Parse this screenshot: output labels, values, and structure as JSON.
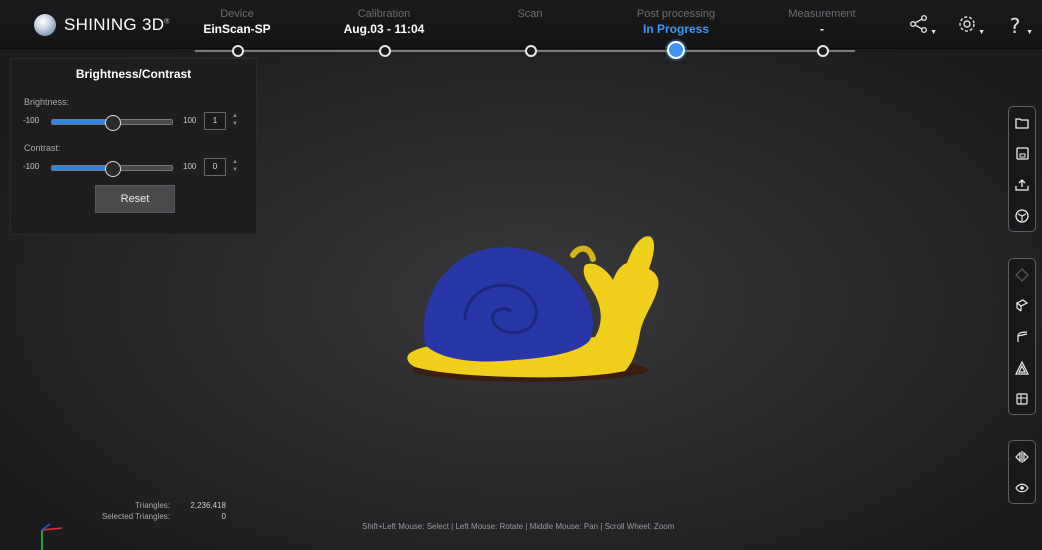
{
  "app": {
    "brand": "SHINING 3D",
    "brand_mark": "®"
  },
  "steps": [
    {
      "label": "Device",
      "value": "EinScan-SP"
    },
    {
      "label": "Calibration",
      "value": "Aug.03 - 11:04"
    },
    {
      "label": "Scan",
      "value": ""
    },
    {
      "label": "Post processing",
      "value": "In Progress"
    },
    {
      "label": "Measurement",
      "value": "-"
    }
  ],
  "panel": {
    "title": "Brightness/Contrast",
    "brightness": {
      "label": "Brightness:",
      "min": "-100",
      "max": "100",
      "value": "1"
    },
    "contrast": {
      "label": "Contrast:",
      "min": "-100",
      "max": "100",
      "value": "0"
    },
    "reset_label": "Reset"
  },
  "stats": {
    "triangles_label": "Triangles:",
    "triangles_value": "2,236,418",
    "selected_label": "Selected Triangles:",
    "selected_value": "0"
  },
  "hint": "Shift+Left Mouse: Select | Left Mouse: Rotate | Middle Mouse: Pan | Scroll Wheel: Zoom",
  "colors": {
    "accent": "#3f95f2",
    "shell": "#2a3aa8",
    "body": "#f2d11e"
  },
  "icons": {
    "top": [
      "share-icon",
      "settings-icon",
      "help-icon"
    ],
    "file_tools": [
      "folder-icon",
      "save-icon",
      "export-icon",
      "mesh-icon"
    ],
    "edit_tools": [
      "eraser-icon",
      "cut-plane-icon",
      "fill-hole-icon",
      "simplify-icon",
      "box-icon"
    ],
    "view_tools": [
      "flip-icon",
      "eye-icon"
    ]
  }
}
